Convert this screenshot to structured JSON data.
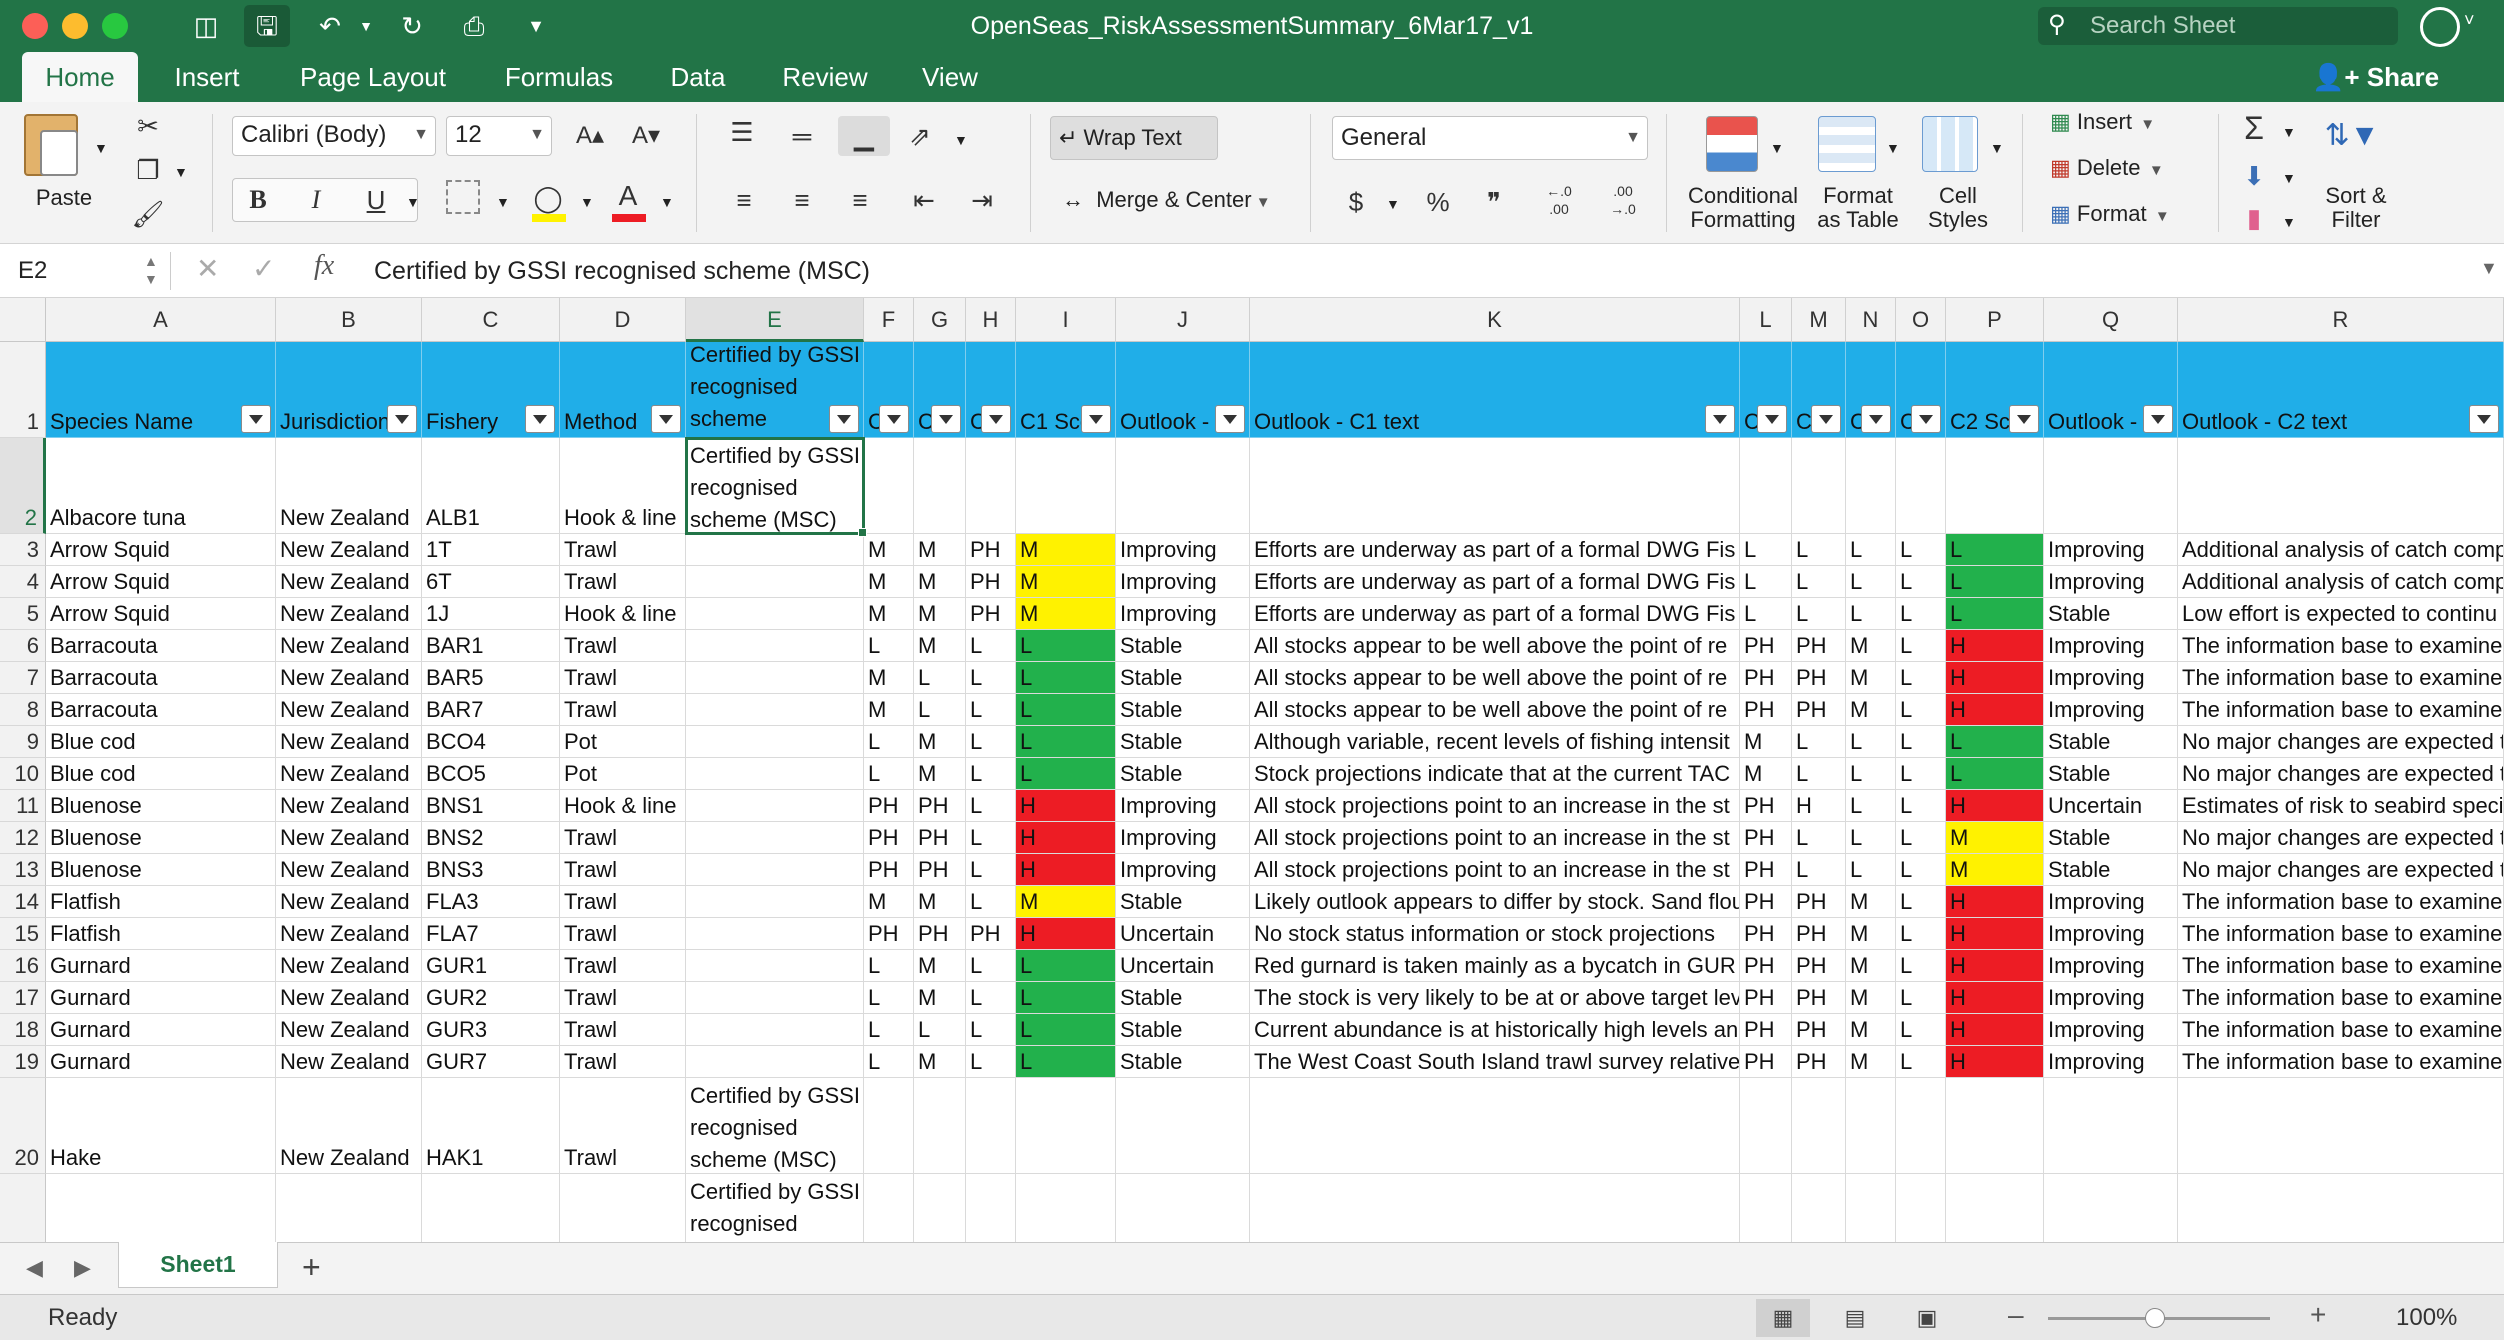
{
  "window": {
    "title": "OpenSeas_RiskAssessmentSummary_6Mar17_v1",
    "search_placeholder": "Search Sheet"
  },
  "ribbon_tabs": [
    {
      "label": "Home",
      "active": true
    },
    {
      "label": "Insert"
    },
    {
      "label": "Page Layout"
    },
    {
      "label": "Formulas"
    },
    {
      "label": "Data"
    },
    {
      "label": "Review"
    },
    {
      "label": "View"
    }
  ],
  "share_label": "Share",
  "ribbon": {
    "paste": "Paste",
    "font_name": "Calibri (Body)",
    "font_size": "12",
    "wrap_text": "Wrap Text",
    "merge_center": "Merge & Center",
    "number_format": "General",
    "conditional_formatting": [
      "Conditional",
      "Formatting"
    ],
    "format_as_table": [
      "Format",
      "as Table"
    ],
    "cell_styles": [
      "Cell",
      "Styles"
    ],
    "insert": "Insert",
    "delete": "Delete",
    "format": "Format",
    "sort_filter": [
      "Sort &",
      "Filter"
    ],
    "bold": "B",
    "italic": "I",
    "underline": "U",
    "currency": "$",
    "percent": "%",
    "comma": "ʔ",
    "inc_decimal": ".0 .00",
    "dec_decimal": ".00 .0"
  },
  "formula_bar": {
    "name_box": "E2",
    "fx": "fx",
    "content": "Certified by GSSI recognised scheme (MSC)"
  },
  "columns": [
    "A",
    "B",
    "C",
    "D",
    "E",
    "F",
    "G",
    "H",
    "I",
    "J",
    "K",
    "L",
    "M",
    "N",
    "O",
    "P",
    "Q",
    "R"
  ],
  "selected_column": "E",
  "header_row": [
    "Species Name",
    "Jurisdiction",
    "Fishery",
    "Method",
    "Certified by GSSI recognised scheme",
    "C",
    "C",
    "C",
    "C1 Sco",
    "Outlook -",
    "Outlook - C1 text",
    "C",
    "C",
    "C",
    "C",
    "C2 Sco",
    "Outlook -",
    "Outlook - C2 text"
  ],
  "rows": [
    {
      "n": "2",
      "cells": [
        "Albacore tuna",
        "New Zealand",
        "ALB1",
        "Hook & line",
        "Certified by GSSI recognised scheme (MSC)",
        "",
        "",
        "",
        "",
        "",
        "",
        "",
        "",
        "",
        "",
        "",
        "",
        ""
      ]
    },
    {
      "n": "3",
      "cells": [
        "Arrow Squid",
        "New Zealand",
        "1T",
        "Trawl",
        "",
        "M",
        "M",
        "PH",
        "M",
        "Improving",
        "Efforts are underway as part of a formal DWG Fis",
        "L",
        "L",
        "L",
        "L",
        "L",
        "Improving",
        "Additional analysis of catch comp"
      ]
    },
    {
      "n": "4",
      "cells": [
        "Arrow Squid",
        "New Zealand",
        "6T",
        "Trawl",
        "",
        "M",
        "M",
        "PH",
        "M",
        "Improving",
        "Efforts are underway as part of a formal DWG Fis",
        "L",
        "L",
        "L",
        "L",
        "L",
        "Improving",
        "Additional analysis of catch comp"
      ]
    },
    {
      "n": "5",
      "cells": [
        "Arrow Squid",
        "New Zealand",
        "1J",
        "Hook & line",
        "",
        "M",
        "M",
        "PH",
        "M",
        "Improving",
        "Efforts are underway as part of a formal DWG Fis",
        "L",
        "L",
        "L",
        "L",
        "L",
        "Stable",
        "Low effort is expected to continu"
      ]
    },
    {
      "n": "6",
      "cells": [
        "Barracouta",
        "New Zealand",
        "BAR1",
        "Trawl",
        "",
        "L",
        "M",
        "L",
        "L",
        "Stable",
        "All stocks appear to be well above the point of re",
        "PH",
        "PH",
        "M",
        "L",
        "H",
        "Improving",
        "The information base to examine"
      ]
    },
    {
      "n": "7",
      "cells": [
        "Barracouta",
        "New Zealand",
        "BAR5",
        "Trawl",
        "",
        "M",
        "L",
        "L",
        "L",
        "Stable",
        "All stocks appear to be well above the point of re",
        "PH",
        "PH",
        "M",
        "L",
        "H",
        "Improving",
        "The information base to examine"
      ]
    },
    {
      "n": "8",
      "cells": [
        "Barracouta",
        "New Zealand",
        "BAR7",
        "Trawl",
        "",
        "M",
        "L",
        "L",
        "L",
        "Stable",
        "All stocks appear to be well above the point of re",
        "PH",
        "PH",
        "M",
        "L",
        "H",
        "Improving",
        "The information base to examine"
      ]
    },
    {
      "n": "9",
      "cells": [
        "Blue cod",
        "New Zealand",
        "BCO4",
        "Pot",
        "",
        "L",
        "M",
        "L",
        "L",
        "Stable",
        "Although variable, recent levels of fishing intensit",
        "M",
        "L",
        "L",
        "L",
        "L",
        "Stable",
        "No major changes are expected t"
      ]
    },
    {
      "n": "10",
      "cells": [
        "Blue cod",
        "New Zealand",
        "BCO5",
        "Pot",
        "",
        "L",
        "M",
        "L",
        "L",
        "Stable",
        "Stock projections indicate that at the current TAC",
        "M",
        "L",
        "L",
        "L",
        "L",
        "Stable",
        "No major changes are expected t"
      ]
    },
    {
      "n": "11",
      "cells": [
        "Bluenose",
        "New Zealand",
        "BNS1",
        "Hook & line",
        "",
        "PH",
        "PH",
        "L",
        "H",
        "Improving",
        "All stock projections point to an increase in the st",
        "PH",
        "H",
        "L",
        "L",
        "H",
        "Uncertain",
        "Estimates of risk to seabird speci"
      ]
    },
    {
      "n": "12",
      "cells": [
        "Bluenose",
        "New Zealand",
        "BNS2",
        "Trawl",
        "",
        "PH",
        "PH",
        "L",
        "H",
        "Improving",
        "All stock projections point to an increase in the st",
        "PH",
        "L",
        "L",
        "L",
        "M",
        "Stable",
        "No major changes are expected t"
      ]
    },
    {
      "n": "13",
      "cells": [
        "Bluenose",
        "New Zealand",
        "BNS3",
        "Trawl",
        "",
        "PH",
        "PH",
        "L",
        "H",
        "Improving",
        "All stock projections point to an increase in the st",
        "PH",
        "L",
        "L",
        "L",
        "M",
        "Stable",
        "No major changes are expected t"
      ]
    },
    {
      "n": "14",
      "cells": [
        "Flatfish",
        "New Zealand",
        "FLA3",
        "Trawl",
        "",
        "M",
        "M",
        "L",
        "M",
        "Stable",
        "Likely outlook appears to differ by stock. Sand flou",
        "PH",
        "PH",
        "M",
        "L",
        "H",
        "Improving",
        "The information base to examine"
      ]
    },
    {
      "n": "15",
      "cells": [
        "Flatfish",
        "New Zealand",
        "FLA7",
        "Trawl",
        "",
        "PH",
        "PH",
        "PH",
        "H",
        "Uncertain",
        "No stock status information or stock projections",
        "PH",
        "PH",
        "M",
        "L",
        "H",
        "Improving",
        "The information base to examine"
      ]
    },
    {
      "n": "16",
      "cells": [
        "Gurnard",
        "New Zealand",
        "GUR1",
        "Trawl",
        "",
        "L",
        "M",
        "L",
        "L",
        "Uncertain",
        "Red gurnard is taken mainly as a bycatch in GUR",
        "PH",
        "PH",
        "M",
        "L",
        "H",
        "Improving",
        "The information base to examine"
      ]
    },
    {
      "n": "17",
      "cells": [
        "Gurnard",
        "New Zealand",
        "GUR2",
        "Trawl",
        "",
        "L",
        "M",
        "L",
        "L",
        "Stable",
        "The stock is very likely to be at or above target lev",
        "PH",
        "PH",
        "M",
        "L",
        "H",
        "Improving",
        "The information base to examine"
      ]
    },
    {
      "n": "18",
      "cells": [
        "Gurnard",
        "New Zealand",
        "GUR3",
        "Trawl",
        "",
        "L",
        "L",
        "L",
        "L",
        "Stable",
        "Current abundance is at historically high levels an",
        "PH",
        "PH",
        "M",
        "L",
        "H",
        "Improving",
        "The information base to examine"
      ]
    },
    {
      "n": "19",
      "cells": [
        "Gurnard",
        "New Zealand",
        "GUR7",
        "Trawl",
        "",
        "L",
        "M",
        "L",
        "L",
        "Stable",
        "The West Coast South Island trawl survey relative",
        "PH",
        "PH",
        "M",
        "L",
        "H",
        "Improving",
        "The information base to examine"
      ]
    },
    {
      "n": "20",
      "cells": [
        "Hake",
        "New Zealand",
        "HAK1",
        "Trawl",
        "Certified by GSSI recognised scheme (MSC)",
        "",
        "",
        "",
        "",
        "",
        "",
        "",
        "",
        "",
        "",
        "",
        "",
        ""
      ]
    },
    {
      "n": "21",
      "cells": [
        "",
        "",
        "",
        "",
        "Certified by GSSI recognised",
        "",
        "",
        "",
        "",
        "",
        "",
        "",
        "",
        "",
        "",
        "",
        "",
        ""
      ]
    }
  ],
  "row1_label": "1",
  "score_colors": {
    "L": "#22b14c",
    "M": "#fff200",
    "H": "#ed1c24"
  },
  "header_color": "#20aee8",
  "sheet_tab": "Sheet1",
  "status": "Ready",
  "zoom": "100%",
  "zoom_fraction": 0.48
}
